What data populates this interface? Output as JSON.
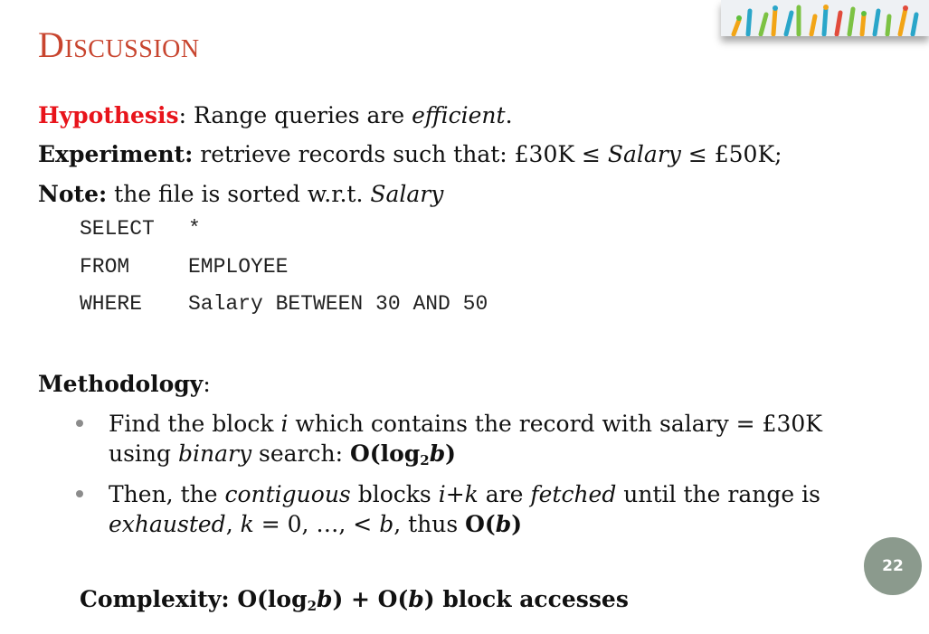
{
  "slide": {
    "title": "Discussion",
    "hypothesis": {
      "label": "Hypothesis",
      "colon": ":",
      "text_before": " Range queries are ",
      "emph": "efficient",
      "text_after": "."
    },
    "experiment": {
      "label": "Experiment:",
      "text_before": " retrieve records such that: £30K ≤ ",
      "var1": "Salary",
      "mid": " ≤ £50K;"
    },
    "note": {
      "label": "Note:",
      "text_before": " the file is sorted w.r.t. ",
      "var": "Salary"
    },
    "sql": {
      "line1_kw": "SELECT",
      "line1_rest": "*",
      "line2_kw": "FROM",
      "line2_rest": "EMPLOYEE",
      "line3_kw": "WHERE",
      "line3_rest": "Salary BETWEEN 30 AND 50"
    },
    "methodology": {
      "label": "Methodology",
      "colon": ":"
    },
    "bullets": [
      {
        "l1_a": "Find the block ",
        "l1_i": "i",
        "l1_b": " which contains the record with salary = £30K",
        "l2_a": "using ",
        "l2_i": "binary",
        "l2_b": " search: ",
        "l2_bold_a": "O(log",
        "l2_sub": "2",
        "l2_bold_var": "b",
        "l2_bold_c": ")"
      },
      {
        "l1_a": "Then, the ",
        "l1_i": "contiguous",
        "l1_b": " blocks ",
        "l1_i2": "i+k",
        "l1_c": " are ",
        "l1_i3": "fetched",
        "l1_d": " until the range is",
        "l2_i": "exhausted",
        "l2_a": ", ",
        "l2_k": "k",
        "l2_b": " = 0, …, < ",
        "l2_bvar": "b",
        "l2_c": ", thus ",
        "l2_bold_a": "O(",
        "l2_bold_var": "b",
        "l2_bold_c": ")"
      }
    ],
    "complexity": {
      "a": "Complexity: O(log",
      "sub": "2",
      "var1": "b",
      "b": ") + O(",
      "var2": "b",
      "c": ") block accesses"
    },
    "page_number": "22"
  },
  "colors": {
    "title": "#c8452f",
    "hypothesis_label": "#e8141b",
    "page_badge": "#8b9a8d",
    "bullet_dot": "#8c8c8c"
  },
  "icons": {
    "banner": "hands-raised-banner-icon"
  }
}
